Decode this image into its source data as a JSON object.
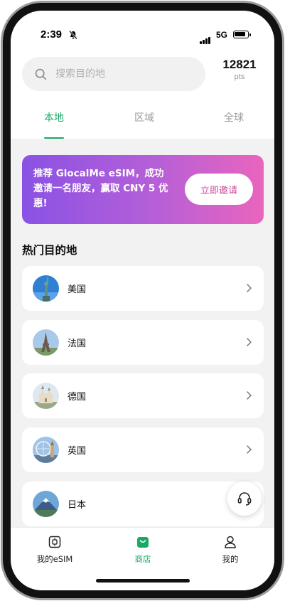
{
  "status_bar": {
    "time": "2:39",
    "network": "5G"
  },
  "search": {
    "placeholder": "搜索目的地"
  },
  "points": {
    "value": "12821",
    "unit": "pts"
  },
  "tabs": [
    {
      "label": "本地",
      "active": true
    },
    {
      "label": "区域",
      "active": false
    },
    {
      "label": "全球",
      "active": false
    }
  ],
  "banner": {
    "text": "推荐 GlocalMe eSIM，成功邀请一名朋友，赢取 CNY 5 优惠!",
    "button_label": "立即邀请",
    "gradient": [
      "#8a52e4",
      "#e965bd"
    ]
  },
  "section_title": "热门目的地",
  "destinations": [
    {
      "name": "美国",
      "icon": "statue-of-liberty-icon"
    },
    {
      "name": "法国",
      "icon": "eiffel-tower-icon"
    },
    {
      "name": "德国",
      "icon": "castle-icon"
    },
    {
      "name": "英国",
      "icon": "london-eye-icon"
    },
    {
      "name": "日本",
      "icon": "mount-fuji-icon"
    }
  ],
  "bottom_nav": [
    {
      "label": "我的eSIM",
      "icon": "esim-chip-icon",
      "active": false
    },
    {
      "label": "商店",
      "icon": "shop-bag-icon",
      "active": true
    },
    {
      "label": "我的",
      "icon": "user-icon",
      "active": false
    }
  ],
  "colors": {
    "accent": "#1aa865",
    "invite_text": "#d1489f",
    "background": "#f2f2f2"
  }
}
